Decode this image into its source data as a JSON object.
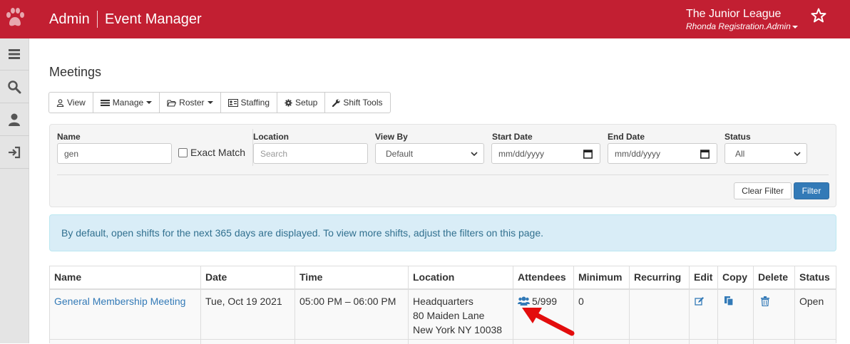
{
  "header": {
    "brand": "Admin",
    "app_name": "Event Manager",
    "org_name": "The Junior League",
    "user_name": "Rhonda Registration.Admin",
    "bg_color": "#c21f32"
  },
  "sidebar": {
    "items": [
      {
        "icon": "menu-icon"
      },
      {
        "icon": "search-icon"
      },
      {
        "icon": "user-icon"
      },
      {
        "icon": "sign-in-icon"
      }
    ]
  },
  "page": {
    "title": "Meetings"
  },
  "toolbar": {
    "buttons": [
      {
        "label": "View",
        "icon": "user-outline-icon",
        "dropdown": false
      },
      {
        "label": "Manage",
        "icon": "list-icon",
        "dropdown": true
      },
      {
        "label": "Roster",
        "icon": "folder-open-icon",
        "dropdown": true
      },
      {
        "label": "Staffing",
        "icon": "id-card-icon",
        "dropdown": false
      },
      {
        "label": "Setup",
        "icon": "cog-icon",
        "dropdown": false
      },
      {
        "label": "Shift Tools",
        "icon": "wrench-icon",
        "dropdown": false
      }
    ]
  },
  "filters": {
    "name_label": "Name",
    "name_value": "gen",
    "exact_match_label": "Exact Match",
    "exact_match_checked": false,
    "location_label": "Location",
    "location_placeholder": "Search",
    "view_by_label": "View By",
    "view_by_value": "Default",
    "start_date_label": "Start Date",
    "start_date_placeholder": "mm/dd/yyyy",
    "end_date_label": "End Date",
    "end_date_placeholder": "mm/dd/yyyy",
    "status_label": "Status",
    "status_value": "All",
    "clear_label": "Clear Filter",
    "filter_label": "Filter"
  },
  "info": {
    "message": "By default, open shifts for the next 365 days are displayed. To view more shifts, adjust the filters on this page."
  },
  "table": {
    "columns": [
      "Name",
      "Date",
      "Time",
      "Location",
      "Attendees",
      "Minimum",
      "Recurring",
      "Edit",
      "Copy",
      "Delete",
      "Status"
    ],
    "rows": [
      {
        "name": "General Membership Meeting",
        "date": "Tue, Oct 19 2021",
        "time": "05:00 PM – 06:00 PM",
        "location_line1": "Headquarters",
        "location_line2": "80 Maiden Lane",
        "location_line3": "New York NY 10038",
        "attendees": "5/999",
        "minimum": "0",
        "recurring": "",
        "status": "Open"
      }
    ]
  },
  "colors": {
    "accent_red": "#c21f32",
    "link_blue": "#337ab7",
    "info_bg": "#d9edf7",
    "info_text": "#31708f"
  }
}
